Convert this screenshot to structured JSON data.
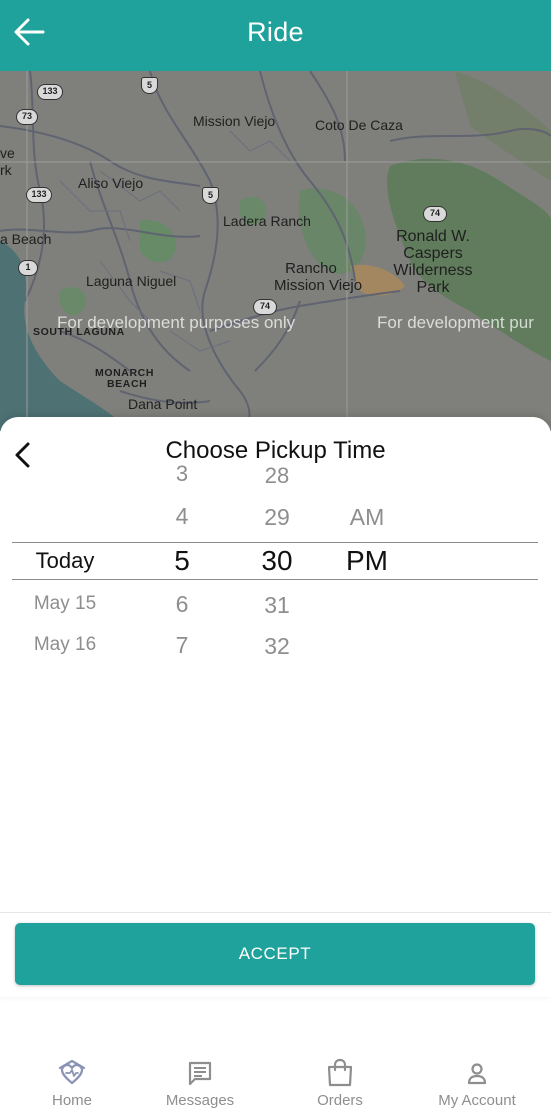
{
  "header": {
    "title": "Ride",
    "back_icon": "arrow-left-icon"
  },
  "map": {
    "watermarks": [
      "For development purposes only",
      "For development pur"
    ],
    "place_labels": {
      "mission_viejo": "Mission Viejo",
      "coto_de_caza": "Coto De Caza",
      "aliso_viejo": "Aliso Viejo",
      "ladera_ranch": "Ladera Ranch",
      "laguna_niguel": "Laguna Niguel",
      "rancho_mission_viejo_1": "Rancho",
      "rancho_mission_viejo_2": "Mission Viejo",
      "ronald_caspers_1": "Ronald W.",
      "ronald_caspers_2": "Caspers",
      "ronald_caspers_3": "Wilderness",
      "ronald_caspers_4": "Park",
      "south_laguna": "SOUTH LAGUNA",
      "monarch_beach_1": "MONARCH",
      "monarch_beach_2": "BEACH",
      "dana_point": "Dana Point",
      "a_beach": "a Beach",
      "ve_fragment": "ve",
      "rk_fragment": "rk"
    },
    "route_shields": [
      "133",
      "73",
      "133",
      "5",
      "5",
      "1",
      "74",
      "74"
    ]
  },
  "picker": {
    "title": "Choose Pickup Time",
    "back_icon": "chevron-left-icon",
    "dates": [
      "Today",
      "May 15",
      "May 16"
    ],
    "hours": [
      "3",
      "4",
      "5",
      "6",
      "7"
    ],
    "minutes": [
      "28",
      "29",
      "30",
      "31",
      "32"
    ],
    "periods": [
      "AM",
      "PM"
    ],
    "selected": {
      "date": "Today",
      "hour": "5",
      "minute": "30",
      "period": "PM"
    }
  },
  "accept_label": "ACCEPT",
  "nav": {
    "items": [
      {
        "label": "Home",
        "icon": "home-heart-icon"
      },
      {
        "label": "Messages",
        "icon": "message-icon"
      },
      {
        "label": "Orders",
        "icon": "shopping-bag-icon"
      },
      {
        "label": "My Account",
        "icon": "person-icon"
      }
    ]
  },
  "colors": {
    "brand": "#1fa29b",
    "selected_text": "#111111",
    "faded_text": "#8e8e8e"
  }
}
